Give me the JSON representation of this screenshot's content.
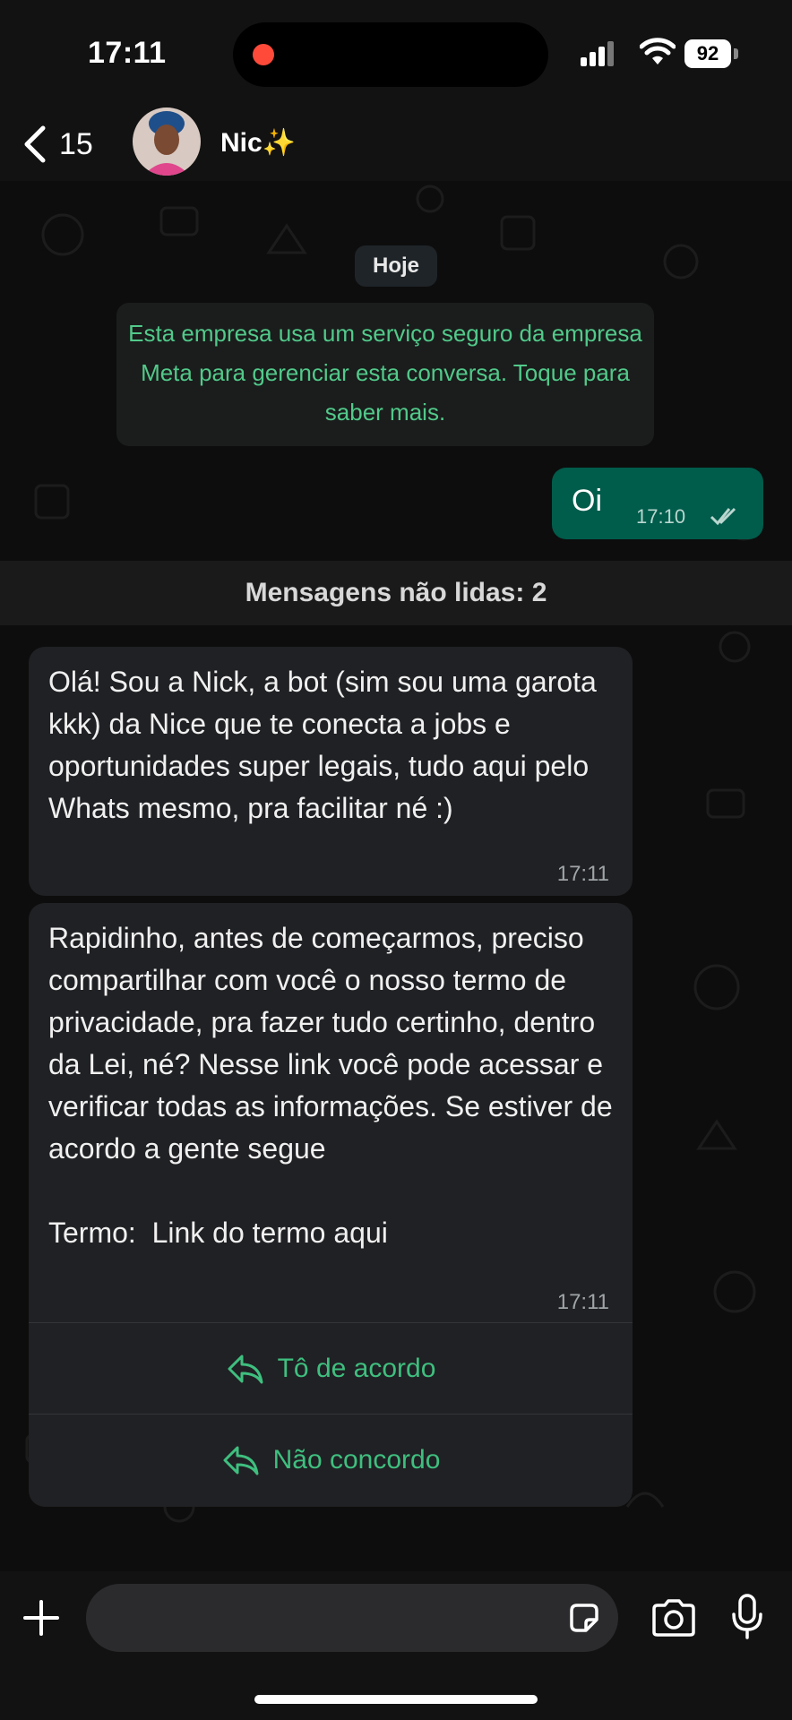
{
  "status_bar": {
    "time": "17:11",
    "battery": "92"
  },
  "header": {
    "back_count": "15",
    "contact_name": "Nic✨"
  },
  "chat": {
    "date": "Hoje",
    "system_note": "Esta empresa usa um serviço seguro da empresa Meta para gerenciar esta conversa. Toque para saber mais.",
    "outgoing": [
      {
        "text": "Oi",
        "time": "17:10"
      }
    ],
    "unread_label": "Mensagens não lidas: 2",
    "incoming": [
      {
        "text": "Olá! Sou a Nick, a bot (sim sou uma garota kkk) da Nice que te conecta a jobs e oportunidades super legais, tudo aqui pelo Whats mesmo, pra facilitar né :)",
        "time": "17:11"
      },
      {
        "text": "Rapidinho, antes de começarmos, preciso compartilhar com você o nosso termo de privacidade, pra fazer tudo certinho, dentro da Lei, né? Nesse link você pode acessar e verificar todas as informações. Se estiver de acordo a gente segue\n\nTermo:  Link do termo aqui",
        "time": "17:11",
        "buttons": [
          "Tô de acordo",
          "Não concordo"
        ]
      }
    ]
  },
  "colors": {
    "outgoing_bubble": "#005c4b",
    "incoming_bubble": "#202124",
    "accent_green": "#3fbf7f",
    "system_text": "#52c98a"
  },
  "icons": [
    "back-chevron-icon",
    "signal-icon",
    "wifi-icon",
    "battery-icon",
    "read-ticks-icon",
    "reply-icon",
    "plus-icon",
    "sticker-icon",
    "camera-icon",
    "mic-icon"
  ]
}
